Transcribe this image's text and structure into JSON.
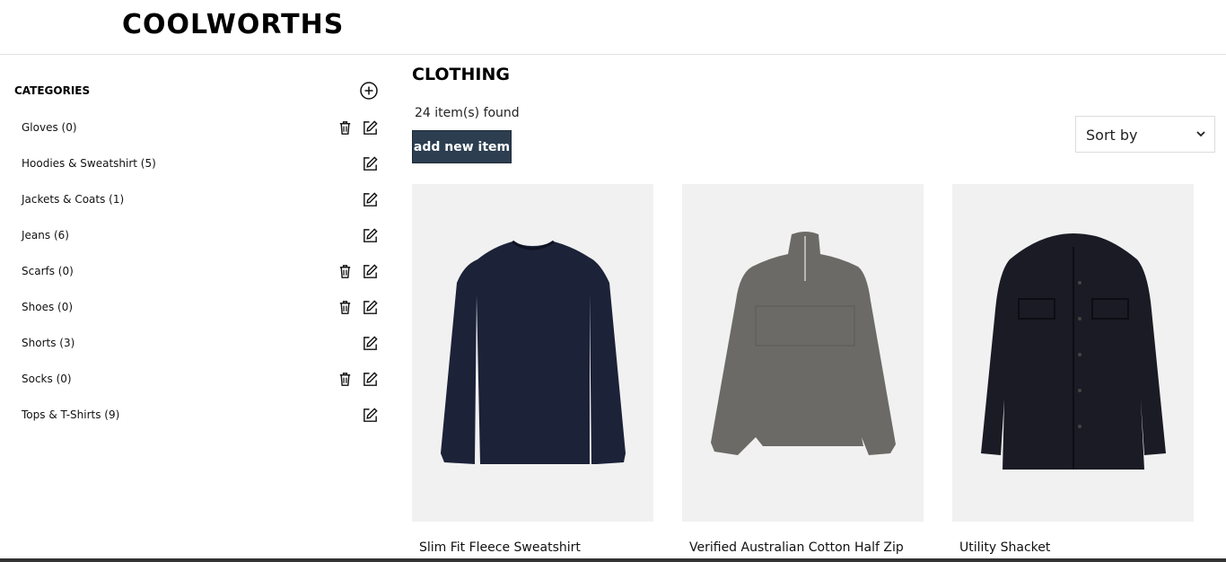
{
  "brand": "COOLWORTHS",
  "sidebar": {
    "heading": "CATEGORIES",
    "categories": [
      {
        "label": "Gloves (0)",
        "deletable": true
      },
      {
        "label": "Hoodies & Sweatshirt (5)",
        "deletable": false
      },
      {
        "label": "Jackets & Coats (1)",
        "deletable": false
      },
      {
        "label": "Jeans (6)",
        "deletable": false
      },
      {
        "label": "Scarfs (0)",
        "deletable": true
      },
      {
        "label": "Shoes (0)",
        "deletable": true
      },
      {
        "label": "Shorts (3)",
        "deletable": false
      },
      {
        "label": "Socks (0)",
        "deletable": true
      },
      {
        "label": "Tops & T-Shirts (9)",
        "deletable": false
      }
    ]
  },
  "main": {
    "title": "CLOTHING",
    "count": "24 item(s) found",
    "add_button": "add new item",
    "sort_label": "Sort by",
    "products": [
      {
        "name": "Slim Fit Fleece Sweatshirt",
        "color": "#1c2238"
      },
      {
        "name": "Verified Australian Cotton Half Zip",
        "color": "#6b6a66"
      },
      {
        "name": "Utility Shacket",
        "color": "#1a1b24"
      }
    ]
  },
  "colors": {
    "button_bg": "#2c3e50",
    "card_bg": "#f1f1f1"
  }
}
